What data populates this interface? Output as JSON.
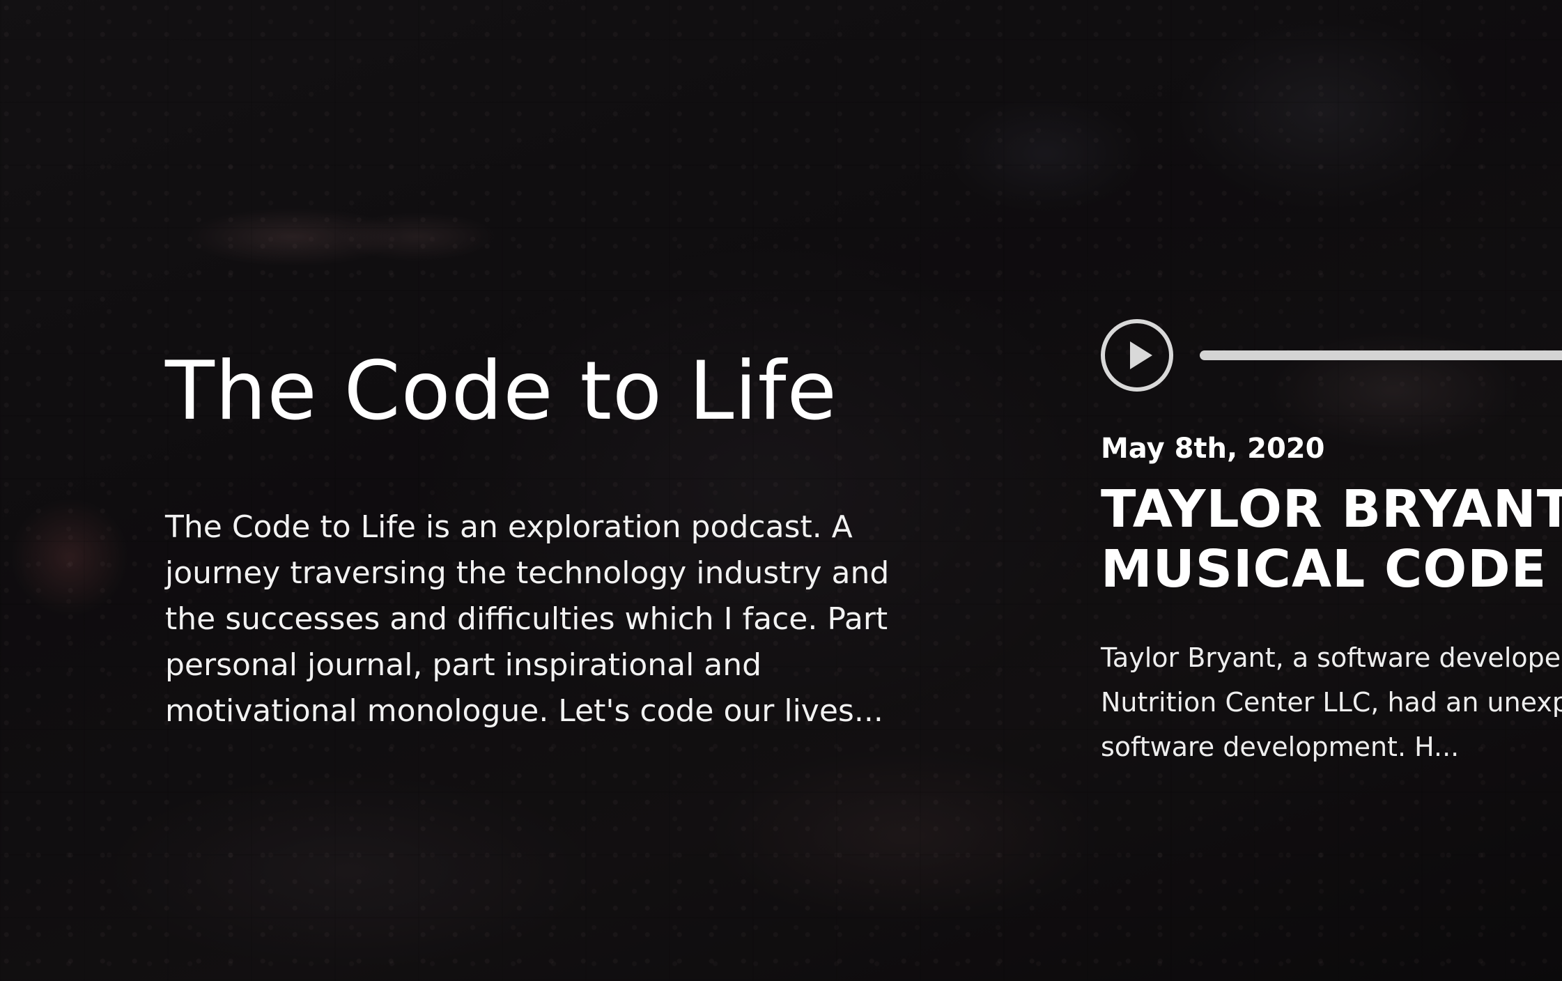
{
  "podcast": {
    "title": "The Code to Life",
    "description": "The Code to Life is an exploration podcast. A journey traversing the technology industry and the successes and difficulties which I face. Part personal journal, part inspirational and motivational monologue. Let's code our lives..."
  },
  "player": {
    "play_icon": "play-icon",
    "progress": 0
  },
  "episode": {
    "date": "May 8th, 2020",
    "title": "TAYLOR BRYANT\nMUSICAL CODE",
    "summary": "Taylor Bryant, a software developer\nNutrition Center LLC, had an unexpe\nsoftware development. H..."
  },
  "colors": {
    "text": "#ffffff",
    "player_ring": "#d9d9d9",
    "progress_track": "#d4d4d4",
    "background": "#141214"
  }
}
